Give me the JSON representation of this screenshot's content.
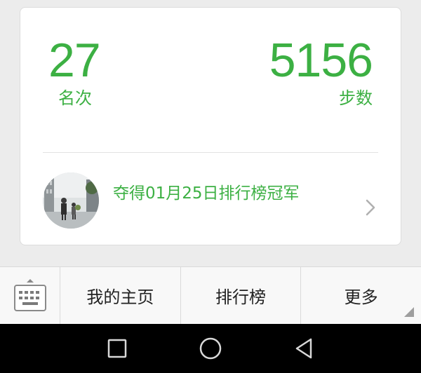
{
  "stats": {
    "rank_value": "27",
    "rank_label": "名次",
    "steps_value": "5156",
    "steps_label": "步数"
  },
  "champion": {
    "text": "夺得01月25日排行榜冠军"
  },
  "menu": {
    "items": [
      {
        "label": "我的主页"
      },
      {
        "label": "排行榜"
      },
      {
        "label": "更多"
      }
    ]
  },
  "icons": {
    "keyboard": "keyboard-icon",
    "chevron": "chevron-right-icon",
    "recents": "recents-square-icon",
    "home": "home-circle-icon",
    "back": "back-triangle-icon"
  },
  "colors": {
    "accent": "#3cb043",
    "background": "#ececec",
    "card": "#ffffff",
    "nav_bar": "#000000"
  }
}
